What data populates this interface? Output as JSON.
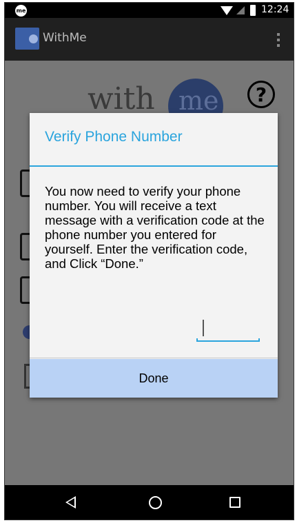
{
  "status_bar": {
    "notification_badge": "me",
    "time": "12:24",
    "icons": [
      "wifi-icon",
      "signal-icon",
      "battery-icon"
    ]
  },
  "app_bar": {
    "title": "WithMe",
    "logo_icon": "withme-logo-icon",
    "overflow_icon": "overflow-menu-icon"
  },
  "background": {
    "logo_text_with": "with",
    "logo_text_me": "me",
    "help_symbol": "?"
  },
  "dialog": {
    "title": "Verify Phone Number",
    "message": "You now need to verify your phone number. You will receive a text message with a verification code at the phone number you entered for yourself. Enter the verification code, and Click “Done.”",
    "code_value": "",
    "done_label": "Done"
  },
  "nav_bar": {
    "icons": [
      "back-icon",
      "home-icon",
      "recent-apps-icon"
    ]
  },
  "colors": {
    "accent": "#2aa4dd",
    "button_bg": "#b9d2f5",
    "dialog_bg": "#f3f3f3",
    "app_bar": "#202020",
    "scrim": "#777777"
  }
}
